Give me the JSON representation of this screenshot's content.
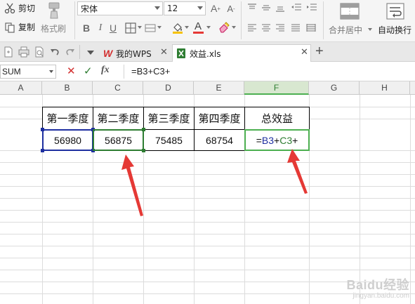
{
  "ribbon": {
    "cut_label": "剪切",
    "copy_label": "复制",
    "format_painter_label": "格式刷",
    "font_name": "宋体",
    "font_size": "12",
    "bold_label": "B",
    "italic_label": "I",
    "underline_label": "U",
    "merge_center_label": "合并居中",
    "auto_wrap_label": "自动换行"
  },
  "tabbar": {
    "tabs": [
      {
        "label": "我的WPS"
      },
      {
        "label": "效益.xls"
      }
    ]
  },
  "formula_bar": {
    "name_box": "SUM",
    "fx_label": "fx",
    "formula": "=B3+C3+"
  },
  "sheet": {
    "columns": [
      "A",
      "B",
      "C",
      "D",
      "E",
      "F",
      "G",
      "H"
    ],
    "selected_column": "F",
    "headers": [
      "第一季度",
      "第二季度",
      "第三季度",
      "第四季度",
      "总效益"
    ],
    "values": [
      "56980",
      "56875",
      "75485",
      "68754"
    ],
    "f3_formula": {
      "prefix": "=",
      "ref1": "B3",
      "op1": "+",
      "ref2": "C3",
      "op2": "+"
    }
  },
  "colors": {
    "ref_b3": "#1e2fa0",
    "ref_c3": "#2e7d32",
    "arrow": "#e53935"
  },
  "watermark": {
    "brand": "Baidu经验",
    "sub": "jingyan.baidu.com"
  }
}
